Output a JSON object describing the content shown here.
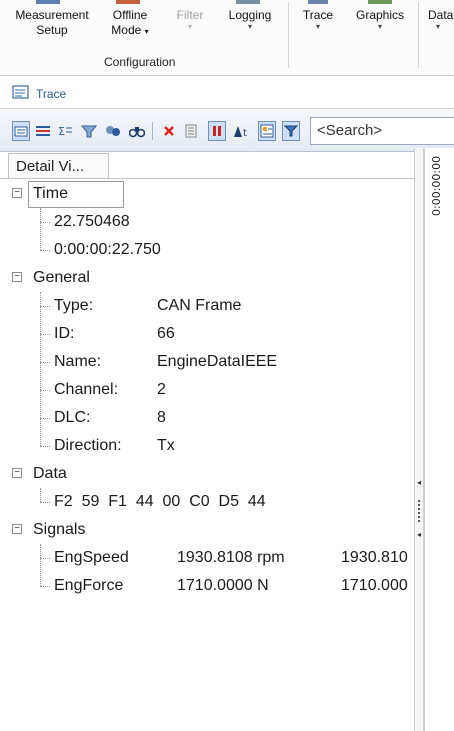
{
  "ribbon": {
    "buttons": [
      {
        "label1": "Measurement",
        "label2": "Setup",
        "arrow": ""
      },
      {
        "label1": "Offline",
        "label2": "Mode",
        "arrow": "▾"
      },
      {
        "label1": "Filter",
        "label2": "",
        "arrow": "▾"
      },
      {
        "label1": "Logging",
        "label2": "",
        "arrow": "▾"
      },
      {
        "label1": "Trace",
        "label2": "",
        "arrow": "▾"
      },
      {
        "label1": "Graphics",
        "label2": "",
        "arrow": "▾"
      },
      {
        "label1": "Data",
        "label2": "",
        "arrow": "▾"
      }
    ],
    "group_label": "Configuration"
  },
  "window": {
    "title": "Trace"
  },
  "toolbar": {
    "search_placeholder": "<Search>"
  },
  "detail_view": {
    "tab_label": "Detail Vi...",
    "time_axis_label": "0:00:00:00",
    "time": {
      "label": "Time",
      "expander": "−",
      "values": [
        "22.750468",
        "0:00:00:22.750"
      ]
    },
    "general": {
      "label": "General",
      "expander": "−",
      "fields": [
        {
          "key": "Type:",
          "value": "CAN Frame"
        },
        {
          "key": "ID:",
          "value": "66"
        },
        {
          "key": "Name:",
          "value": "EngineDataIEEE"
        },
        {
          "key": "Channel:",
          "value": "2"
        },
        {
          "key": "DLC:",
          "value": "8"
        },
        {
          "key": "Direction:",
          "value": "Tx"
        }
      ]
    },
    "data": {
      "label": "Data",
      "expander": "−",
      "bytes": "F2  59  F1  44  00  C0  D5  44"
    },
    "signals": {
      "label": "Signals",
      "expander": "−",
      "items": [
        {
          "name": "EngSpeed",
          "value": "1930.8108 rpm",
          "raw": "1930.810"
        },
        {
          "name": "EngForce",
          "value": "1710.0000 N",
          "raw": "1710.000"
        }
      ]
    }
  }
}
